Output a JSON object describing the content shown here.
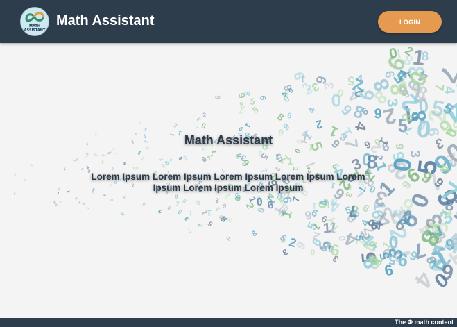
{
  "header": {
    "logo_text_line1": "MATH",
    "logo_text_line2": "ASSISTANT",
    "title": "Math Assistant",
    "login_label": "LOGIN"
  },
  "hero": {
    "title": "Math Assistant",
    "text": "Lorem Ipsum Lorem Ipsum Lorem Ipsum Lorem Ipsum Lorem Ipsum Lorem Ipsum Lorem Ipsum",
    "background_icon": "scattered-digits-background"
  },
  "footer": {
    "text": "The Φ math content"
  },
  "colors": {
    "header_bg": "#2d3d4c",
    "login_bg": "#e59a4f",
    "page_bg": "#f4f4f4",
    "digit_palette": [
      "#5a7ea3",
      "#8fd0dc",
      "#6fb8cf",
      "#a9d8a3",
      "#7bb67a",
      "#b9c3cc",
      "#6a7f93",
      "#4f9fc0"
    ]
  }
}
